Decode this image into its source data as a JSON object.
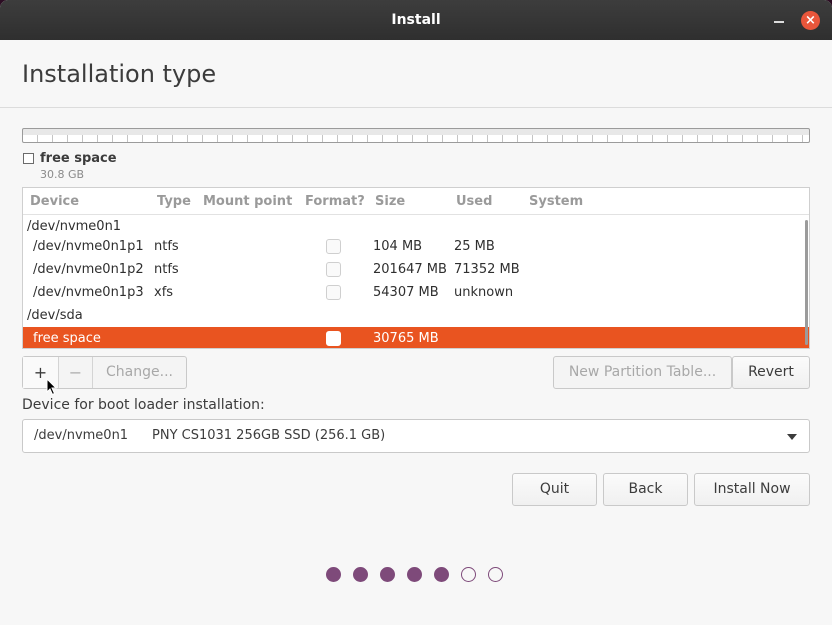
{
  "window": {
    "title": "Install"
  },
  "page": {
    "heading": "Installation type"
  },
  "legend": {
    "label": "free space",
    "size": "30.8 GB"
  },
  "table": {
    "columns": [
      "Device",
      "Type",
      "Mount point",
      "Format?",
      "Size",
      "Used",
      "System"
    ],
    "rows": [
      {
        "device": "/dev/nvme0n1",
        "type": "",
        "size": "",
        "used": "",
        "format_checkbox": false
      },
      {
        "device": "/dev/nvme0n1p1",
        "type": "ntfs",
        "size": "104 MB",
        "used": "25 MB",
        "format_checkbox": true
      },
      {
        "device": "/dev/nvme0n1p2",
        "type": "ntfs",
        "size": "201647 MB",
        "used": "71352 MB",
        "format_checkbox": true
      },
      {
        "device": "/dev/nvme0n1p3",
        "type": "xfs",
        "size": "54307 MB",
        "used": "unknown",
        "format_checkbox": true
      },
      {
        "device": "/dev/sda",
        "type": "",
        "size": "",
        "used": "",
        "format_checkbox": false
      },
      {
        "device": "free space",
        "type": "",
        "size": "30765 MB",
        "used": "",
        "format_checkbox": true,
        "selected": true
      }
    ]
  },
  "partition_buttons": {
    "add": "+",
    "remove": "−",
    "change": "Change...",
    "new_table": "New Partition Table...",
    "revert": "Revert"
  },
  "boot_loader": {
    "label": "Device for boot loader installation:",
    "device": "/dev/nvme0n1",
    "name": "PNY CS1031 256GB SSD (256.1 GB)"
  },
  "footer_buttons": {
    "quit": "Quit",
    "back": "Back",
    "install_now": "Install Now"
  },
  "progress": {
    "total_steps": 7,
    "completed_steps": 5
  },
  "colors": {
    "accent": "#e95420",
    "progress_dot": "#7e4a7a",
    "titlebar": "#333333"
  }
}
